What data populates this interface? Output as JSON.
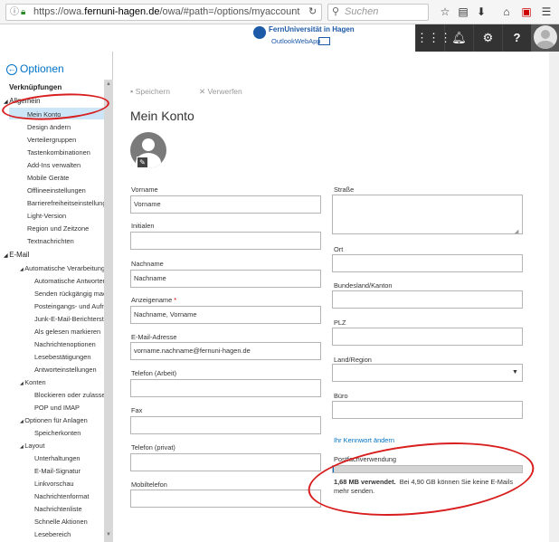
{
  "browser": {
    "url_prefix": "https://owa.",
    "url_domain": "fernuni-hagen.de",
    "url_path": "/owa/#path=/options/myaccount",
    "search_placeholder": "Suchen"
  },
  "brand": {
    "name": "FernUniversität in Hagen",
    "app": "OutlookWebApp"
  },
  "sidebar": {
    "back_title": "Optionen",
    "shortcuts": "Verknüpfungen",
    "general": "Allgemein",
    "general_items": [
      "Mein Konto",
      "Design ändern",
      "Verteilergruppen",
      "Tastenkombinationen",
      "Add-Ins verwalten",
      "Mobile Geräte",
      "Offlineeinstellungen",
      "Barrierefreiheitseinstellungen",
      "Light-Version",
      "Region und Zeitzone",
      "Textnachrichten"
    ],
    "email": "E-Mail",
    "auto_processing": "Automatische Verarbeitung",
    "auto_items": [
      "Automatische Antworten",
      "Senden rückgängig machen",
      "Posteingangs- und Aufräumregeln",
      "Junk-E-Mail-Berichterstattung",
      "Als gelesen markieren",
      "Nachrichtenoptionen",
      "Lesebestätigungen",
      "Antworteinstellungen"
    ],
    "accounts": "Konten",
    "accounts_items": [
      "Blockieren oder zulassen",
      "POP und IMAP"
    ],
    "attachments": "Optionen für Anlagen",
    "attachments_items": [
      "Speicherkonten"
    ],
    "layout": "Layout",
    "layout_items": [
      "Unterhaltungen",
      "E-Mail-Signatur",
      "Linkvorschau",
      "Nachrichtenformat",
      "Nachrichtenliste",
      "Schnelle Aktionen",
      "Lesebereich"
    ]
  },
  "toolbar": {
    "save": "Speichern",
    "discard": "Verwerfen"
  },
  "page": {
    "title": "Mein Konto"
  },
  "form": {
    "first_name_label": "Vorname",
    "first_name_value": "Vorname",
    "initials_label": "Initialen",
    "initials_value": "",
    "last_name_label": "Nachname",
    "last_name_value": "Nachname",
    "display_name_label": "Anzeigename",
    "display_name_required": "*",
    "display_name_value": "Nachname, Vorname",
    "email_label": "E-Mail-Adresse",
    "email_value": "vorname.nachname@fernuni-hagen.de",
    "work_phone_label": "Telefon (Arbeit)",
    "fax_label": "Fax",
    "home_phone_label": "Telefon (privat)",
    "mobile_label": "Mobiltelefon",
    "street_label": "Straße",
    "city_label": "Ort",
    "state_label": "Bundesland/Kanton",
    "zip_label": "PLZ",
    "country_label": "Land/Region",
    "office_label": "Büro",
    "change_password": "Ihr Kennwort ändern",
    "mailbox_label": "Postfachverwendung",
    "mailbox_used": "1,68 MB verwendet.",
    "mailbox_text": "Bei 4,90 GB können Sie keine E-Mails mehr senden.",
    "mailbox_fraction": 0.0003
  },
  "colors": {
    "accent": "#0072c6",
    "highlight": "#cde6f7",
    "annotation": "#d81e1e",
    "header_dark": "#333333"
  }
}
